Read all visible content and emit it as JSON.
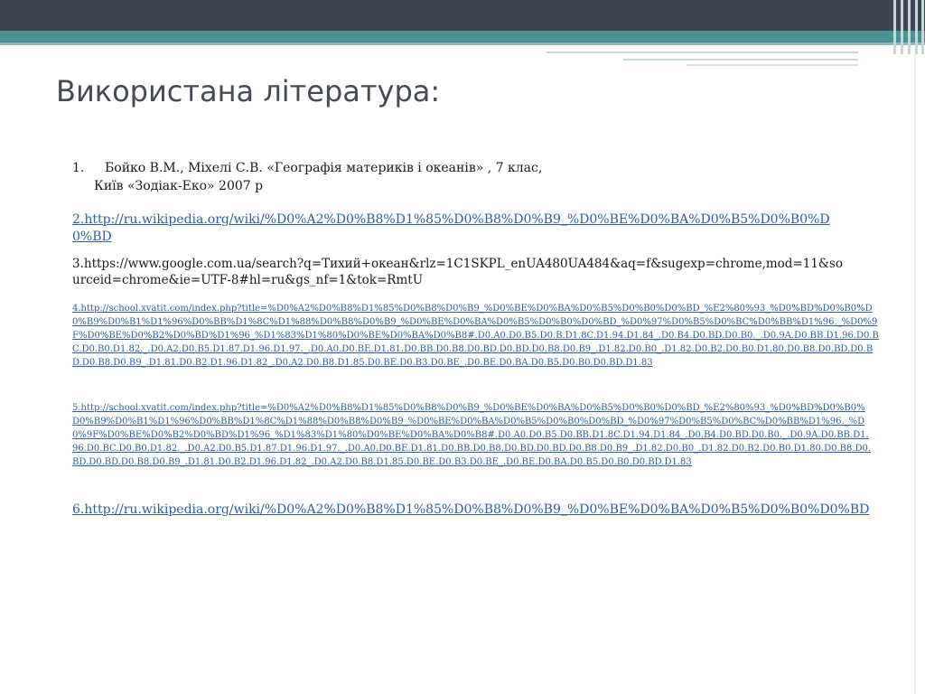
{
  "slide": {
    "title": "Використана література:"
  },
  "references": [
    {
      "number": "1.",
      "line1": "Бойко В.М., Міхелі С.В. «Географія материків і океанів» , 7 клас,",
      "line2": "Київ «Зодіак-Еко»  2007 р"
    },
    {
      "text": "2.http://ru.wikipedia.org/wiki/%D0%A2%D0%B8%D1%85%D0%B8%D0%B9_%D0%BE%D0%BA%D0%B5%D0%B0%D0%BD"
    },
    {
      "text": "3.https://www.google.com.ua/search?q=Тихий+океан&rlz=1C1SKPL_enUA480UA484&aq=f&sugexp=chrome,mod=11&sourceid=chrome&ie=UTF-8#hl=ru&gs_nf=1&tok=RmtU"
    },
    {
      "text": "4.http://school.xvatit.com/index.php?title=%D0%A2%D0%B8%D1%85%D0%B8%D0%B9_%D0%BE%D0%BA%D0%B5%D0%B0%D0%BD_%E2%80%93_%D0%BD%D0%B0%D0%B9%D0%B1%D1%96%D0%BB%D1%8C%D1%88%D0%B8%D0%B9_%D0%BE%D0%BA%D0%B5%D0%B0%D0%BD_%D0%97%D0%B5%D0%BC%D0%BB%D1%96._%D0%9F%D0%BE%D0%B2%D0%BD%D1%96_%D1%83%D1%80%D0%BE%D0%BA%D0%B8#.D0.A0.D0.B5.D0.B.D1.8C.D1.94.D1.84_.D0.B4.D0.BD.D0.B0._.D0.9A.D0.BB.D1.96.D0.BC.D0.B0.D1.82._.D0.A2.D0.B5.D1.87.D1.96.D1.97._.D0.A0.D0.BE.D1.81.D0.BB.D0.B8.D0.BD.D0.BD.D0.B8.D0.B9_.D1.82.D0.B0_.D1.82.D0.B2.D0.B0.D1.80.D0.B8.D0.BD.D0.BD.D0.B8.D0.B9_.D1.81.D0.B2.D1.96.D1.82_.D0.A2.D0.B8.D1.85.D0.BE.D0.B3.D0.BE_.D0.BE.D0.BA.D0.B5.D0.B0.D0.BD.D1.83"
    },
    {
      "text": "5.http://school.xvatit.com/index.php?title=%D0%A2%D0%B8%D1%85%D0%B8%D0%B9_%D0%BE%D0%BA%D0%B5%D0%B0%D0%BD_%E2%80%93_%D0%BD%D0%B0%D0%B9%D0%B1%D1%96%D0%BB%D1%8C%D1%88%D0%B8%D0%B9_%D0%BE%D0%BA%D0%B5%D0%B0%D0%BD_%D0%97%D0%B5%D0%BC%D0%BB%D1%96._%D0%9F%D0%BE%D0%B2%D0%BD%D1%96_%D1%83%D1%80%D0%BE%D0%BA%D0%B8#.D0.A0.D0.B5.D0.BB.D1.8C.D1.94.D1.84_.D0.B4.D0.BD.D0.B0._.D0.9A.D0.BB.D1.96.D0.BC.D0.B0.D1.82._.D0.A2.D0.B5.D1.87.D1.96.D1.97._.D0.A0.D0.BE.D1.81.D0.BB.D0.B8.D0.BD.D0.BD.D0.B8.D0.B9_.D1.82.D0.B0_.D1.82.D0.B2.D0.B0.D1.80.D0.B8.D0.BD.D0.BD.D0.B8.D0.B9_.D1.81.D0.B2.D1.96.D1.82_.D0.A2.D0.B8.D1.85.D0.BE.D0.B3.D0.BE_.D0.BE.D0.BA.D0.B5.D0.B0.D0.BD.D1.83"
    },
    {
      "text": "6.http://ru.wikipedia.org/wiki/%D0%A2%D0%B8%D1%85%D0%B8%D0%B9_%D0%BE%D0%BA%D0%B5%D0%B0%D0%BD"
    }
  ],
  "colors": {
    "header_dark": "#3f4451",
    "header_teal": "#4c9194",
    "title": "#454a55",
    "link": "#2e5f9e"
  }
}
